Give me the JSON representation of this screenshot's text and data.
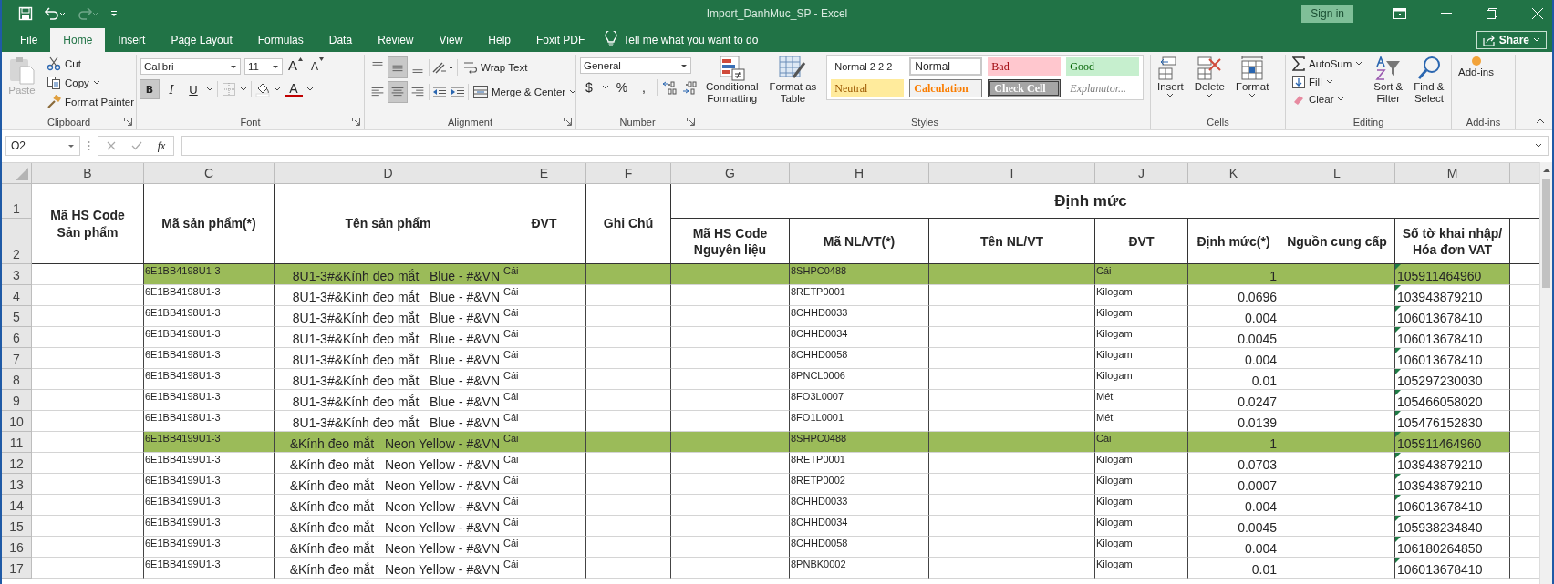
{
  "window": {
    "title": "Import_DanhMuc_SP  -  Excel",
    "sign_in": "Sign in"
  },
  "tabs": [
    {
      "label": "File",
      "selected": false
    },
    {
      "label": "Home",
      "selected": true
    },
    {
      "label": "Insert",
      "selected": false
    },
    {
      "label": "Page Layout",
      "selected": false
    },
    {
      "label": "Formulas",
      "selected": false
    },
    {
      "label": "Data",
      "selected": false
    },
    {
      "label": "Review",
      "selected": false
    },
    {
      "label": "View",
      "selected": false
    },
    {
      "label": "Help",
      "selected": false
    },
    {
      "label": "Foxit PDF",
      "selected": false
    }
  ],
  "tell_me": "Tell me what you want to do",
  "share": "Share",
  "ribbon": {
    "clipboard": {
      "label": "Clipboard",
      "paste": {
        "label": "Paste",
        "disabled": true
      },
      "cut": "Cut",
      "copy": "Copy",
      "format_painter": "Format Painter"
    },
    "font": {
      "label": "Font",
      "name": "Calibri",
      "size": "11",
      "grow": "A",
      "shrink": "A",
      "color_label": "A",
      "styles": [
        {
          "kind": "bold",
          "label": "B",
          "on": true
        },
        {
          "kind": "italic",
          "label": "I",
          "on": false
        },
        {
          "kind": "underline",
          "label": "U",
          "on": false
        }
      ]
    },
    "alignment": {
      "label": "Alignment",
      "wrap_text": "Wrap Text",
      "merge": "Merge & Center",
      "vertical": [
        {
          "kind": "top",
          "on": false
        },
        {
          "kind": "middle",
          "on": true
        },
        {
          "kind": "bottom",
          "on": false
        }
      ],
      "horizontal": [
        {
          "kind": "left",
          "on": false
        },
        {
          "kind": "center",
          "on": true
        },
        {
          "kind": "right",
          "on": false
        }
      ]
    },
    "number": {
      "label": "Number",
      "format": "General",
      "currency": "$",
      "percent": "%",
      "comma": ","
    },
    "styles": {
      "label": "Styles",
      "conditional": [
        "Conditional",
        "Formatting"
      ],
      "table": [
        "Format as",
        "Table"
      ],
      "gallery": [
        {
          "kind": "plain",
          "label": "Normal 2 2 2"
        },
        {
          "kind": "normal",
          "label": "Normal"
        },
        {
          "kind": "bad",
          "label": "Bad"
        },
        {
          "kind": "good",
          "label": "Good"
        },
        {
          "kind": "neutral",
          "label": "Neutral"
        },
        {
          "kind": "calculation",
          "label": "Calculation"
        },
        {
          "kind": "check",
          "label": "Check Cell"
        },
        {
          "kind": "explanatory",
          "label": "Explanator..."
        }
      ]
    },
    "cells": {
      "label": "Cells",
      "buttons": [
        {
          "kind": "insert",
          "label": "Insert"
        },
        {
          "kind": "delete",
          "label": "Delete"
        },
        {
          "kind": "format",
          "label": "Format"
        }
      ]
    },
    "editing": {
      "label": "Editing",
      "autosum": "AutoSum",
      "fill": "Fill",
      "clear": "Clear",
      "sort": [
        "Sort &",
        "Filter"
      ],
      "find": [
        "Find &",
        "Select"
      ]
    },
    "addins": {
      "label": "Add-ins",
      "button": "Add-ins"
    }
  },
  "formula_bar": {
    "name_box": "O2",
    "fx": "fx"
  },
  "sheet": {
    "columns": [
      "B",
      "C",
      "D",
      "E",
      "F",
      "G",
      "H",
      "I",
      "J",
      "K",
      "L",
      "M"
    ],
    "header_rows": [
      "1",
      "2"
    ],
    "headers": [
      "Mã HS Code Sản phẩm",
      "Mã sản phẩm(*)",
      "Tên sản phẩm",
      "ĐVT",
      "Ghi Chú"
    ],
    "group_header": "Định mức",
    "group_columns": [
      "Mã HS Code Nguyên liệu",
      "Mã NL/VT(*)",
      "Tên NL/VT",
      "ĐVT",
      "Định mức(*)",
      "Nguồn cung cấp",
      "Số tờ khai nhập/ Hóa đơn VAT"
    ],
    "rows": [
      {
        "number": "3",
        "highlighted": true,
        "product_code": "6E1BB4198U1-3",
        "product_name": "8U1-3#&Kính đeo mắt   Blue - #&VN",
        "unit": "Cái",
        "material_code": "8SHPC0488",
        "material_unit": "Cái",
        "norm": "1",
        "declaration": "105911464960"
      },
      {
        "number": "4",
        "highlighted": false,
        "product_code": "6E1BB4198U1-3",
        "product_name": "8U1-3#&Kính đeo mắt   Blue - #&VN",
        "unit": "Cái",
        "material_code": "8RETP0001",
        "material_unit": "Kilogam",
        "norm": "0.0696",
        "declaration": "103943879210"
      },
      {
        "number": "5",
        "highlighted": false,
        "product_code": "6E1BB4198U1-3",
        "product_name": "8U1-3#&Kính đeo mắt   Blue - #&VN",
        "unit": "Cái",
        "material_code": "8CHHD0033",
        "material_unit": "Kilogam",
        "norm": "0.004",
        "declaration": "106013678410"
      },
      {
        "number": "6",
        "highlighted": false,
        "product_code": "6E1BB4198U1-3",
        "product_name": "8U1-3#&Kính đeo mắt   Blue - #&VN",
        "unit": "Cái",
        "material_code": "8CHHD0034",
        "material_unit": "Kilogam",
        "norm": "0.0045",
        "declaration": "106013678410"
      },
      {
        "number": "7",
        "highlighted": false,
        "product_code": "6E1BB4198U1-3",
        "product_name": "8U1-3#&Kính đeo mắt   Blue - #&VN",
        "unit": "Cái",
        "material_code": "8CHHD0058",
        "material_unit": "Kilogam",
        "norm": "0.004",
        "declaration": "106013678410"
      },
      {
        "number": "8",
        "highlighted": false,
        "product_code": "6E1BB4198U1-3",
        "product_name": "8U1-3#&Kính đeo mắt   Blue - #&VN",
        "unit": "Cái",
        "material_code": "8PNCL0006",
        "material_unit": "Kilogam",
        "norm": "0.01",
        "declaration": "105297230030"
      },
      {
        "number": "9",
        "highlighted": false,
        "product_code": "6E1BB4198U1-3",
        "product_name": "8U1-3#&Kính đeo mắt   Blue - #&VN",
        "unit": "Cái",
        "material_code": "8FO3L0007",
        "material_unit": "Mét",
        "norm": "0.0247",
        "declaration": "105466058020"
      },
      {
        "number": "10",
        "highlighted": false,
        "product_code": "6E1BB4198U1-3",
        "product_name": "8U1-3#&Kính đeo mắt   Blue - #&VN",
        "unit": "Cái",
        "material_code": "8FO1L0001",
        "material_unit": "Mét",
        "norm": "0.0139",
        "declaration": "105476152830"
      },
      {
        "number": "11",
        "highlighted": true,
        "product_code": "6E1BB4199U1-3",
        "product_name": "&Kính đeo mắt   Neon Yellow - #&VN",
        "unit": "Cái",
        "material_code": "8SHPC0488",
        "material_unit": "Cái",
        "norm": "1",
        "declaration": "105911464960"
      },
      {
        "number": "12",
        "highlighted": false,
        "product_code": "6E1BB4199U1-3",
        "product_name": "&Kính đeo mắt   Neon Yellow - #&VN",
        "unit": "Cái",
        "material_code": "8RETP0001",
        "material_unit": "Kilogam",
        "norm": "0.0703",
        "declaration": "103943879210"
      },
      {
        "number": "13",
        "highlighted": false,
        "product_code": "6E1BB4199U1-3",
        "product_name": "&Kính đeo mắt   Neon Yellow - #&VN",
        "unit": "Cái",
        "material_code": "8RETP0002",
        "material_unit": "Kilogam",
        "norm": "0.0007",
        "declaration": "103943879210"
      },
      {
        "number": "14",
        "highlighted": false,
        "product_code": "6E1BB4199U1-3",
        "product_name": "&Kính đeo mắt   Neon Yellow - #&VN",
        "unit": "Cái",
        "material_code": "8CHHD0033",
        "material_unit": "Kilogam",
        "norm": "0.004",
        "declaration": "106013678410"
      },
      {
        "number": "15",
        "highlighted": false,
        "product_code": "6E1BB4199U1-3",
        "product_name": "&Kính đeo mắt   Neon Yellow - #&VN",
        "unit": "Cái",
        "material_code": "8CHHD0034",
        "material_unit": "Kilogam",
        "norm": "0.0045",
        "declaration": "105938234840"
      },
      {
        "number": "16",
        "highlighted": false,
        "product_code": "6E1BB4199U1-3",
        "product_name": "&Kính đeo mắt   Neon Yellow - #&VN",
        "unit": "Cái",
        "material_code": "8CHHD0058",
        "material_unit": "Kilogam",
        "norm": "0.004",
        "declaration": "106180264850"
      },
      {
        "number": "17",
        "highlighted": false,
        "product_code": "6E1BB4199U1-3",
        "product_name": "&Kính đeo mắt   Neon Yellow - #&VN",
        "unit": "Cái",
        "material_code": "8PNBK0002",
        "material_unit": "Kilogam",
        "norm": "0.01",
        "declaration": "106013678410"
      }
    ]
  }
}
